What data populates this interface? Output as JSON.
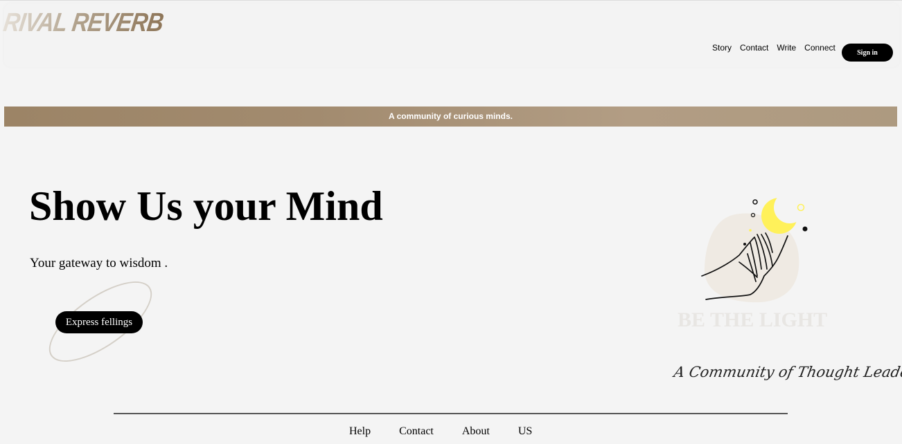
{
  "header": {
    "logo": "RIVAL REVERB",
    "nav": [
      "Story",
      "Contact",
      "Write",
      "Connect"
    ],
    "signin_label": "Sign in"
  },
  "banner": {
    "text": "A community of curious minds."
  },
  "hero": {
    "title": "Show Us your Mind",
    "subtitle": "Your gateway to wisdom .",
    "cta_label": "Express fellings"
  },
  "illustration": {
    "brand": "BE THE LIGHT",
    "tagline": "A Community of Thought Leaders",
    "icons": [
      "hand-icon",
      "crescent-moon-icon"
    ],
    "colors": {
      "moon": "#fff15a",
      "blob": "#efeae3"
    }
  },
  "footer": {
    "links": [
      "Help",
      "Contact",
      "About",
      "US"
    ]
  },
  "colors": {
    "accent": "#a18a6d",
    "button": "#000000",
    "background": "#f4f4f4"
  }
}
